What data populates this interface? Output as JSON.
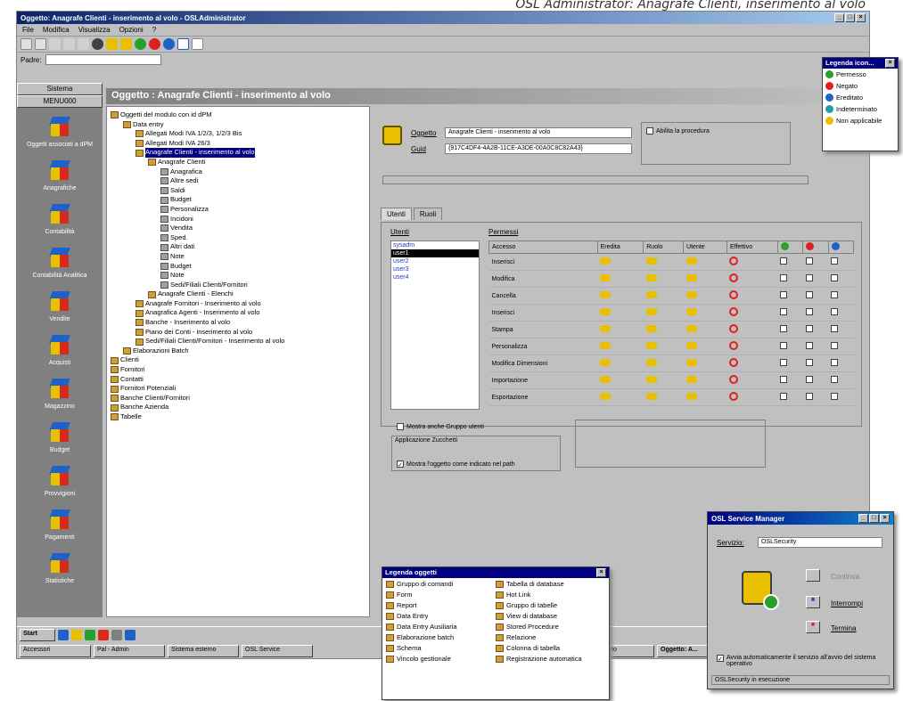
{
  "caption": "OSL Administrator: Anagrafe Clienti, inserimento al volo",
  "window": {
    "title": "Oggetto: Anagrafe Clienti - inserimento al volo - OSLAdministrator"
  },
  "menu": [
    "File",
    "Modifica",
    "Visualizza",
    "Opzioni",
    "?"
  ],
  "path": {
    "label": "Padre:",
    "value": ""
  },
  "left": {
    "header1": "Sistema",
    "header2": "MENU000",
    "items": [
      "Oggetti associati a dPM",
      "Anagrafiche",
      "Contabilità",
      "Contabilità Analitica",
      "Vendite",
      "Acquisti",
      "Magazzino",
      "Budget",
      "Provvigioni",
      "Pagamenti",
      "Statistiche"
    ]
  },
  "main_title": "Oggetto : Anagrafe Clienti - inserimento al volo",
  "tree": [
    {
      "t": "Oggetti del modulo con id dPM",
      "d": 0
    },
    {
      "t": "Data entry",
      "d": 1
    },
    {
      "t": "Allegati Modi IVA 1/2/3, 1/2/3 Bis",
      "d": 2
    },
    {
      "t": "Allegati Modi IVA 26/3",
      "d": 2
    },
    {
      "t": "Anagrafe Clienti - inserimento al volo",
      "d": 2,
      "sel": true
    },
    {
      "t": "Anagrafe Clienti",
      "d": 3
    },
    {
      "t": "Anagrafica",
      "d": 4
    },
    {
      "t": "Altre sedi",
      "d": 4
    },
    {
      "t": "Saldi",
      "d": 4
    },
    {
      "t": "Budget",
      "d": 4
    },
    {
      "t": "Personalizza",
      "d": 4
    },
    {
      "t": "Incidoni",
      "d": 4
    },
    {
      "t": "Vendita",
      "d": 4
    },
    {
      "t": "Sped.",
      "d": 4
    },
    {
      "t": "Altri dati",
      "d": 4
    },
    {
      "t": "Note",
      "d": 4
    },
    {
      "t": "Budget",
      "d": 4
    },
    {
      "t": "Note",
      "d": 4
    },
    {
      "t": "Sedi/Filiali Clienti/Fornitori",
      "d": 4
    },
    {
      "t": "Anagrafe Clienti - Elenchi",
      "d": 3
    },
    {
      "t": "Anagrafe Fornitori - Inserimento al volo",
      "d": 2
    },
    {
      "t": "Anagrafica Agenti - Inserimento al volo",
      "d": 2
    },
    {
      "t": "Banche - Inserimento al volo",
      "d": 2
    },
    {
      "t": "Piano dei Conti - inserimento al volo",
      "d": 2
    },
    {
      "t": "Sedi/Filiali Clienti/Fornitori - Inserimento al volo",
      "d": 2
    },
    {
      "t": "Elaborazioni Batch",
      "d": 1
    },
    {
      "t": "Clienti",
      "d": 0
    },
    {
      "t": "Fornitori",
      "d": 0
    },
    {
      "t": "Contatti",
      "d": 0
    },
    {
      "t": "Fornitori Potenziali",
      "d": 0
    },
    {
      "t": "Banche Clienti/Fornitori",
      "d": 0
    },
    {
      "t": "Banche Azienda",
      "d": 0
    },
    {
      "t": "Tabelle",
      "d": 0
    }
  ],
  "detail": {
    "oggetto_label": "Oggetto",
    "oggetto_value": "Anagrafe Clienti - inserimento al volo",
    "guid_label": "Guid",
    "guid_value": "{917C4DF4-4A2B-11CE-A3DE-00A0C8C82A43}",
    "abilita_label": "Abilita la procedura"
  },
  "tabs": [
    "Utenti",
    "Ruoli"
  ],
  "utenti": {
    "label": "Utenti",
    "items": [
      "sysadm",
      "user1",
      "user2",
      "user3",
      "user4"
    ],
    "selected": 1
  },
  "permessi": {
    "label": "Permessi",
    "cols": [
      "Accesso",
      "Eredita",
      "Ruolo",
      "Utente",
      "Effettivo"
    ],
    "rows": [
      "Inserisci",
      "Modifica",
      "Cancella",
      "Inserisci",
      "Stampa",
      "Personalizza",
      "Modifica Dimensioni",
      "Importazione",
      "Esportazione"
    ]
  },
  "options": {
    "mostra": "Mostra anche Gruppo utenti",
    "applicazione": "Applicazione Zucchetti",
    "mostra_oggetto": "Mostra l'oggetto come indicato nel path"
  },
  "legend1": {
    "title": "Legenda icon...",
    "items": [
      {
        "label": "Permesso",
        "color": "#2aa02a"
      },
      {
        "label": "Negato",
        "color": "#e02020"
      },
      {
        "label": "Ereditato",
        "color": "#1e62c8"
      },
      {
        "label": "Indeterminato",
        "color": "#20a0a0"
      },
      {
        "label": "Non applicabile",
        "color": "#e8c000"
      }
    ]
  },
  "legend2": {
    "title": "Legenda oggetti",
    "left": [
      "Gruppo di comandi",
      "Form",
      "Report",
      "Data Entry",
      "Data Entry Ausiliaria",
      "Elaborazione batch",
      "Schema",
      "Vincolo gestionale"
    ],
    "right": [
      "Tabella di database",
      "Hot Link",
      "Gruppo di tabelle",
      "View di database",
      "Stored Procedure",
      "Relazione",
      "Colonna di tabella",
      "Registrazione automatica"
    ]
  },
  "service": {
    "title": "OSL Service Manager",
    "server_label": "Servizio:",
    "server_value": "OSLSecurity",
    "buttons": [
      "Continua",
      "Interrompi",
      "Termina"
    ],
    "autostart": "Avvia automaticamente il servizio all'avvio del sistema operativo",
    "status": "OSLSecurity in esecuzione"
  },
  "taskbar": {
    "start": "Start",
    "tasks": [
      "Accessori",
      "Pal - Admin",
      "Sistema esterno",
      "OSL Service",
      "Calendario",
      "Oggetto: A..."
    ]
  }
}
